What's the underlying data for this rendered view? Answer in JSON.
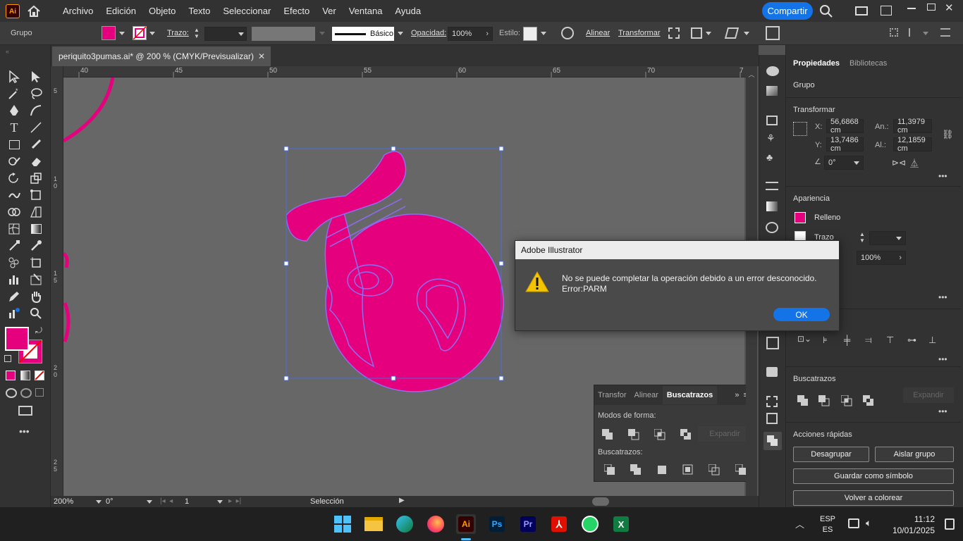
{
  "app": {
    "logo": "Ai",
    "share_label": "Compartir"
  },
  "menu": [
    "Archivo",
    "Edición",
    "Objeto",
    "Texto",
    "Seleccionar",
    "Efecto",
    "Ver",
    "Ventana",
    "Ayuda"
  ],
  "control": {
    "selection_type": "Grupo",
    "stroke_label": "Trazo:",
    "brush_label": "Básico",
    "opacity_label": "Opacidad:",
    "opacity_value": "100%",
    "style_label": "Estilo:",
    "align_label": "Alinear",
    "transform_label": "Transformar"
  },
  "document": {
    "tab_title": "periquito3pumas.ai* @ 200 % (CMYK/Previsualizar)"
  },
  "rulers": {
    "h": [
      "40",
      "45",
      "50",
      "55",
      "60",
      "65",
      "70",
      "7"
    ],
    "v": [
      "5",
      "1\n0",
      "1\n5",
      "2\n0",
      "2\n5"
    ]
  },
  "status": {
    "zoom": "200%",
    "rotation": "0°",
    "artboard": "1",
    "mode": "Selección"
  },
  "panel": {
    "tabs": [
      "Propiedades",
      "Bibliotecas"
    ],
    "group_label": "Grupo",
    "transform_title": "Transformar",
    "x_label": "X:",
    "x_value": "56,6868 cm",
    "y_label": "Y:",
    "y_value": "13,7486 cm",
    "w_label": "An.:",
    "w_value": "11,3979 cm",
    "h_label": "Al.:",
    "h_value": "12,1859 cm",
    "angle_value": "0°",
    "appearance_title": "Apariencia",
    "fill_label": "Relleno",
    "stroke_label": "Trazo",
    "opacity_value": "100%",
    "pathfinder_title": "Buscatrazos",
    "expand_label": "Expandir",
    "quick_actions_title": "Acciones rápidas",
    "ungroup": "Desagrupar",
    "isolate": "Aislar grupo",
    "save_symbol": "Guardar como símbolo",
    "recolor": "Volver a colorear"
  },
  "pathfinder_panel": {
    "tabs": [
      "Transfor",
      "Alinear",
      "Buscatrazos"
    ],
    "shape_modes": "Modos de forma:",
    "expand": "Expandir",
    "pathfinders": "Buscatrazos:"
  },
  "dialog": {
    "title": "Adobe Illustrator",
    "message": "No se puede completar la operación debido a un error desconocido.",
    "error": "Error:PARM",
    "ok": "OK"
  },
  "taskbar": {
    "lang1": "ESP",
    "lang2": "ES",
    "time": "11:12",
    "date": "10/01/2025",
    "apps": [
      "windows-start",
      "file-explorer",
      "edge",
      "firefox",
      "illustrator",
      "photoshop",
      "premiere",
      "acrobat",
      "whatsapp",
      "excel"
    ]
  },
  "colors": {
    "magenta": "#E5007E",
    "accent_blue": "#1473e6",
    "selection_blue": "#4a6cd4"
  }
}
